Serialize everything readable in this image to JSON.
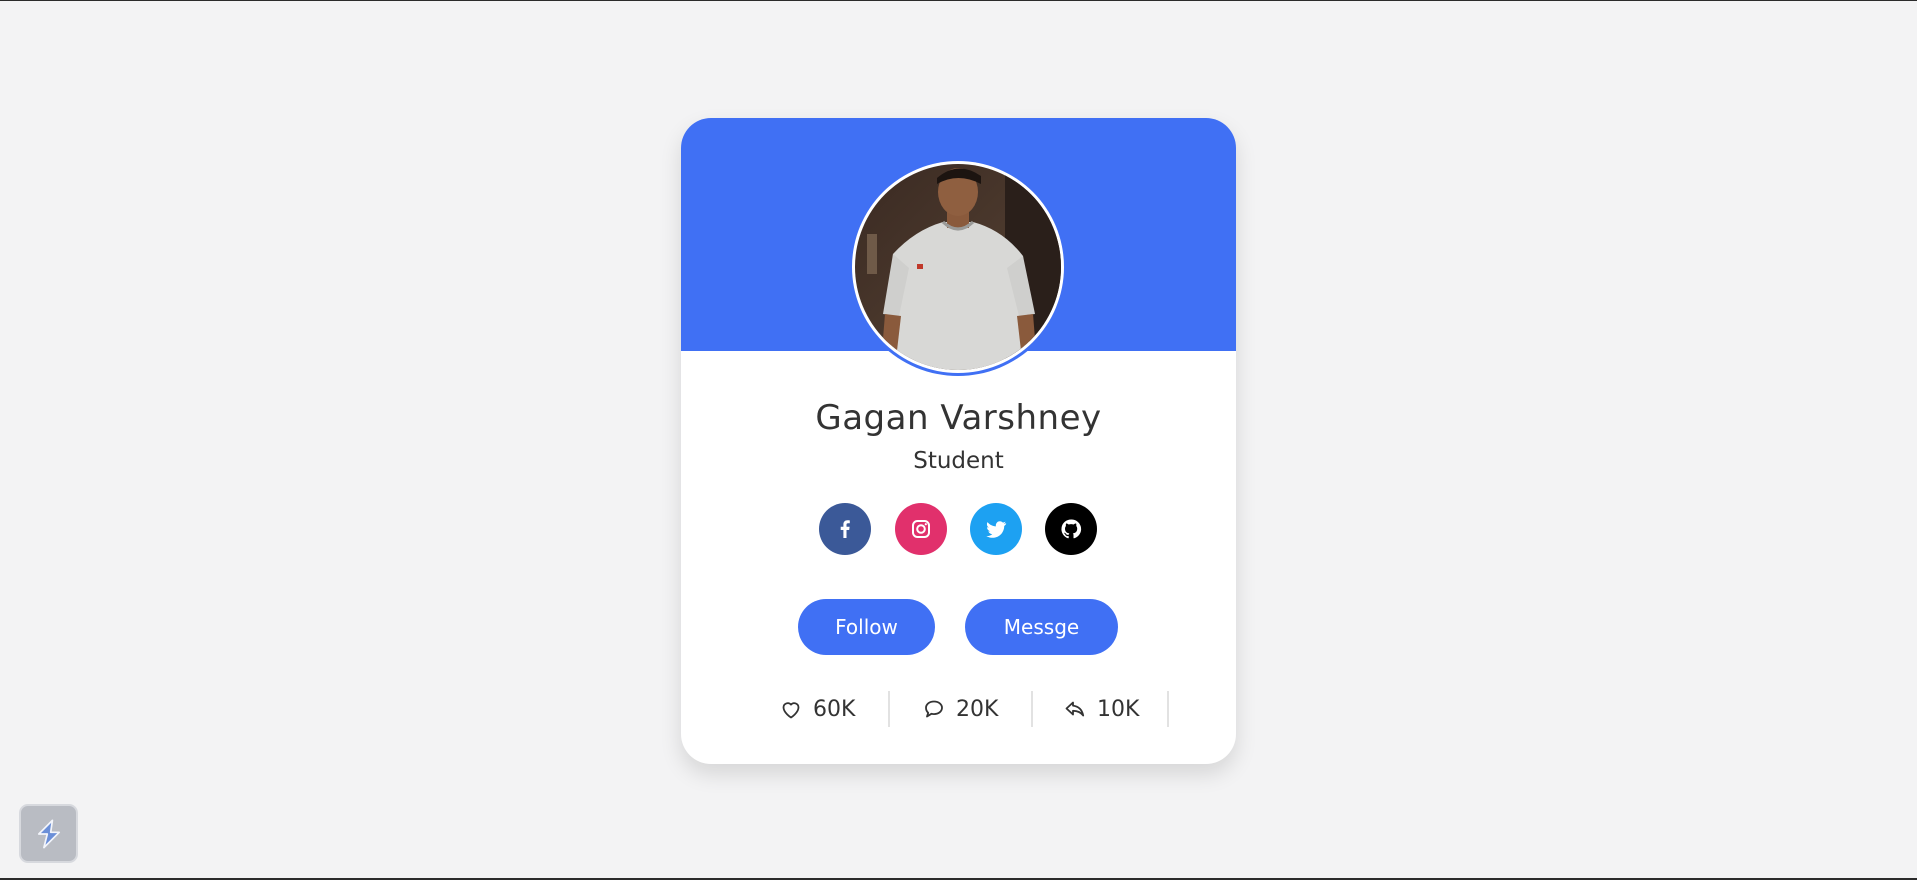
{
  "profile": {
    "name": "Gagan Varshney",
    "job": "Student",
    "avatar_alt": "Profile photo"
  },
  "socials": [
    {
      "name": "facebook",
      "icon": "facebook-icon",
      "color": "#3b5998"
    },
    {
      "name": "instagram",
      "icon": "instagram-icon",
      "color": "#e1306c"
    },
    {
      "name": "twitter",
      "icon": "twitter-icon",
      "color": "#1da1f2"
    },
    {
      "name": "github",
      "icon": "github-icon",
      "color": "#000000"
    }
  ],
  "buttons": {
    "follow": "Follow",
    "message": "Messge"
  },
  "stats": {
    "likes": "60K",
    "comments": "20K",
    "shares": "10K"
  },
  "colors": {
    "accent": "#4070f4",
    "background": "#f3f3f4",
    "card": "#ffffff",
    "text": "#333333"
  }
}
